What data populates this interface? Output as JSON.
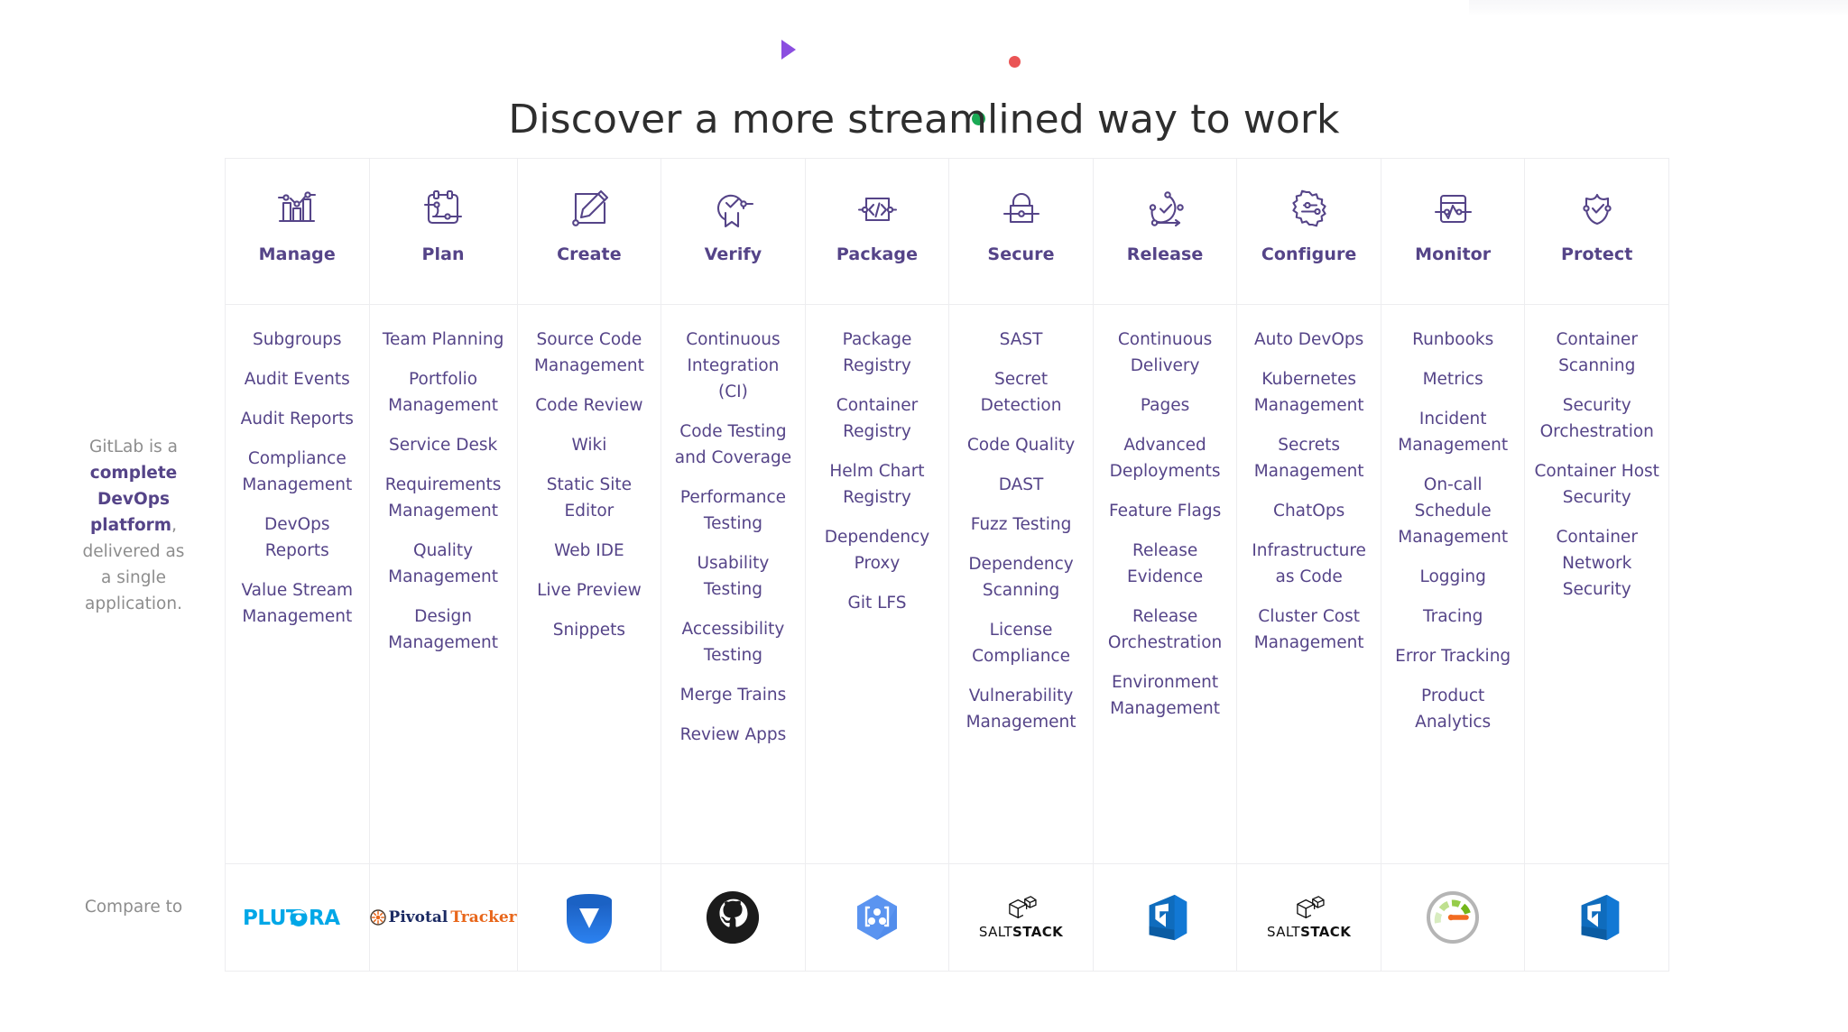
{
  "hero": {
    "title": "Discover a more streamlined way to work",
    "decorations": [
      {
        "name": "triangle",
        "color": "#8b4ee0"
      },
      {
        "name": "dot-red",
        "color": "#ea5455"
      },
      {
        "name": "dot-green",
        "color": "#1aaa55"
      }
    ]
  },
  "side": {
    "blurb_prefix": "GitLab is a ",
    "blurb_highlight": "complete DevOps platform",
    "blurb_suffix": ", delivered as a single application.",
    "compare_label": "Compare to"
  },
  "colors": {
    "accent_purple": "#554488",
    "muted_gray": "#8d8d8d",
    "title_gray": "#2e2e2e",
    "grid_line": "#ededf0"
  },
  "stages": [
    {
      "label": "Manage",
      "icon": "manage-chart-icon",
      "features": [
        "Subgroups",
        "Audit Events",
        "Audit Reports",
        "Compliance Management",
        "DevOps Reports",
        "Value Stream Management"
      ],
      "compare_logo": "plutora-logo",
      "compare_logo_text": "PLUTORA"
    },
    {
      "label": "Plan",
      "icon": "plan-board-icon",
      "features": [
        "Team Planning",
        "Portfolio Management",
        "Service Desk",
        "Requirements Management",
        "Quality Management",
        "Design Management"
      ],
      "compare_logo": "pivotal-tracker-logo",
      "compare_logo_text": "PivotalTracker"
    },
    {
      "label": "Create",
      "icon": "create-pencil-icon",
      "features": [
        "Source Code Management",
        "Code Review",
        "Wiki",
        "Static Site Editor",
        "Web IDE",
        "Live Preview",
        "Snippets"
      ],
      "compare_logo": "bitbucket-logo",
      "compare_logo_text": ""
    },
    {
      "label": "Verify",
      "icon": "verify-badge-icon",
      "features": [
        "Continuous Integration (CI)",
        "Code Testing and Coverage",
        "Performance Testing",
        "Usability Testing",
        "Accessibility Testing",
        "Merge Trains",
        "Review Apps"
      ],
      "compare_logo": "github-logo",
      "compare_logo_text": ""
    },
    {
      "label": "Package",
      "icon": "package-code-icon",
      "features": [
        "Package Registry",
        "Container Registry",
        "Helm Chart Registry",
        "Dependency Proxy",
        "Git LFS"
      ],
      "compare_logo": "google-container-registry-logo",
      "compare_logo_text": ""
    },
    {
      "label": "Secure",
      "icon": "secure-lock-icon",
      "features": [
        "SAST",
        "Secret Detection",
        "Code Quality",
        "DAST",
        "Fuzz Testing",
        "Dependency Scanning",
        "License Compliance",
        "Vulnerability Management"
      ],
      "compare_logo": "saltstack-logo",
      "compare_logo_text": "SALTSTACK"
    },
    {
      "label": "Release",
      "icon": "release-circle-icon",
      "features": [
        "Continuous Delivery",
        "Pages",
        "Advanced Deployments",
        "Feature Flags",
        "Release Evidence",
        "Release Orchestration",
        "Environment Management"
      ],
      "compare_logo": "azure-devops-logo",
      "compare_logo_text": ""
    },
    {
      "label": "Configure",
      "icon": "configure-gear-icon",
      "features": [
        "Auto DevOps",
        "Kubernetes Management",
        "Secrets Management",
        "ChatOps",
        "Infrastructure as Code",
        "Cluster Cost Management"
      ],
      "compare_logo": "saltstack-logo",
      "compare_logo_text": "SALTSTACK"
    },
    {
      "label": "Monitor",
      "icon": "monitor-graph-icon",
      "features": [
        "Runbooks",
        "Metrics",
        "Incident Management",
        "On-call Schedule Management",
        "Logging",
        "Tracing",
        "Error Tracking",
        "Product Analytics"
      ],
      "compare_logo": "new-relic-gauge-logo",
      "compare_logo_text": ""
    },
    {
      "label": "Protect",
      "icon": "protect-shield-icon",
      "features": [
        "Container Scanning",
        "Security Orchestration",
        "Container Host Security",
        "Container Network Security"
      ],
      "compare_logo": "azure-devops-logo",
      "compare_logo_text": ""
    }
  ]
}
